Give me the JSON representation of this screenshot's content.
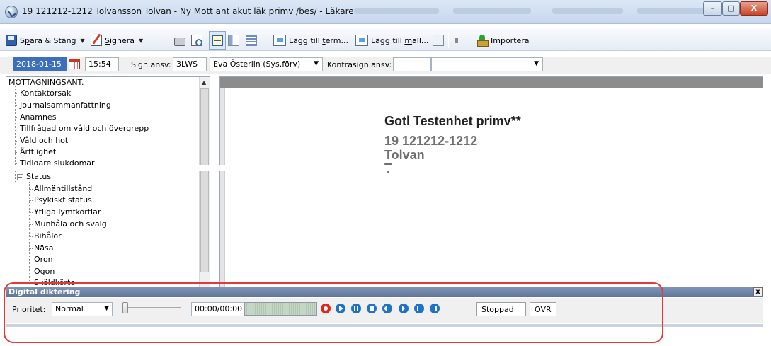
{
  "window": {
    "title": "19 121212-1212 Tolvansson Tolvan - Ny Mott ant akut läk primv /bes/ - Läkare",
    "controls": {
      "minimize": "–",
      "maximize": "□",
      "close": "X"
    }
  },
  "toolbar": {
    "save_close": {
      "prefix": "S",
      "underlined": "p",
      "suffix": "ara & Stäng"
    },
    "sign": {
      "underlined": "S",
      "suffix": "ignera"
    },
    "add_term": {
      "prefix": "Lägg till ",
      "underlined": "t",
      "suffix": "erm..."
    },
    "add_template": {
      "prefix": "Lägg till ",
      "underlined": "m",
      "suffix": "all..."
    },
    "import": "Importera",
    "icons": [
      "save-icon",
      "sign-icon",
      "print-icon",
      "print-preview-icon",
      "layout-editor-icon",
      "layout-split-icon",
      "layout-grid-icon",
      "term-icon",
      "template-icon",
      "dictation-icon",
      "speaker-icon",
      "import-icon"
    ]
  },
  "signing": {
    "date": "2018-01-15",
    "time": "15:54",
    "sign_label": "Sign.ansv:",
    "sign_code": "3LWS",
    "signer": "Eva Österlin (Sys.förv)",
    "contra_label": "Kontrasign.ansv:",
    "contra_code": "",
    "contra_name": ""
  },
  "tree": {
    "root": "MOTTAGNINGSANT.",
    "items": [
      "Kontaktorsak",
      "Journalsammanfattning",
      "Anamnes",
      "Tillfrågad om våld och övergrepp",
      "Våld och hot",
      "Ärftlighet",
      "Tidigare sjukdomar"
    ],
    "status_group": {
      "label": "Status",
      "expander": "−",
      "children": [
        "Allmäntillstånd",
        "Psykiskt status",
        "Ytliga lymfkörtlar",
        "Munhåla och svalg",
        "Bihålor",
        "Näsa",
        "Öron",
        "Ögon",
        "Sköldkörtel"
      ]
    }
  },
  "document": {
    "unit": "Gotl Testenhet primv**",
    "personnummer": "19  121212-1212",
    "first_name": "Tolvan",
    "partial_line": "T"
  },
  "dictation": {
    "title": "Digital diktering",
    "priority_label": "Prioritet:",
    "priority_value": "Normal",
    "time": "00:00/00:00",
    "status": "Stoppad",
    "mode": "OVR",
    "close": "x",
    "buttons": [
      "record",
      "play",
      "pause",
      "stop",
      "rewind",
      "fast-forward",
      "skip-start",
      "skip-end"
    ]
  },
  "colors": {
    "titlebar": "#c7d8ee",
    "selected_date_bg": "#3d6fbf",
    "editor_header": "#8c8c8c",
    "dict_header": "#5f7699",
    "record": "#e0261c",
    "playback": "#1e73c8",
    "annotation_outline": "#e23a3a"
  }
}
